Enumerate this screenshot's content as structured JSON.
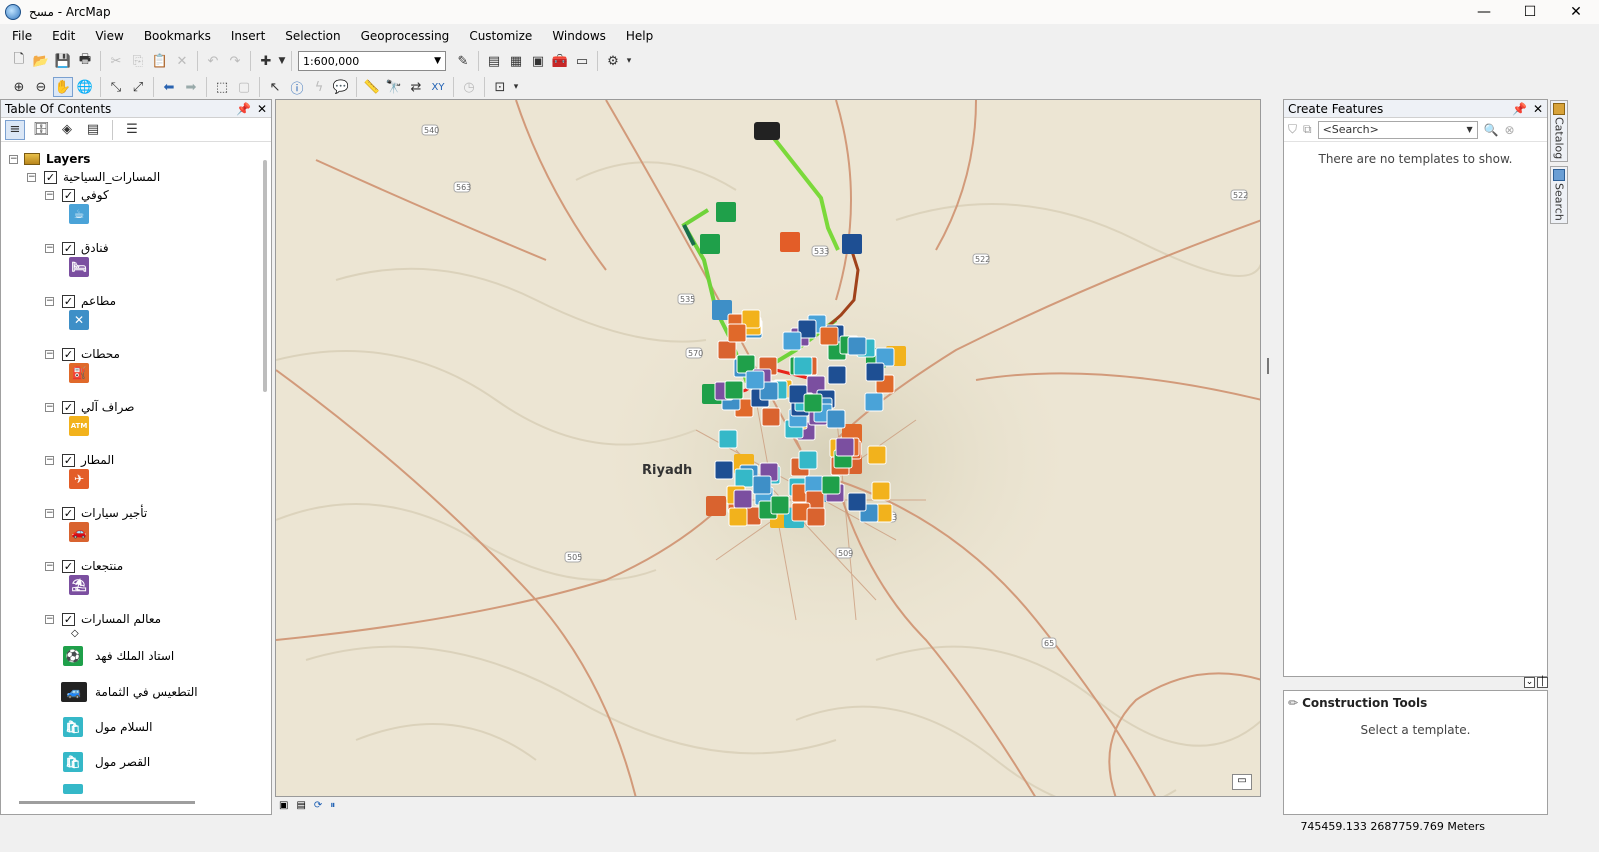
{
  "window": {
    "title": "مسح - ArcMap",
    "minimize": "—",
    "maximize": "☐",
    "close": "✕"
  },
  "menu": [
    "File",
    "Edit",
    "View",
    "Bookmarks",
    "Insert",
    "Selection",
    "Geoprocessing",
    "Customize",
    "Windows",
    "Help"
  ],
  "toolbar": {
    "scale": "1:600,000"
  },
  "toc": {
    "title": "Table Of Contents",
    "root": "Layers",
    "group": "المسارات_السياحية",
    "layers": [
      {
        "name": "كوفي",
        "color": "#4aa3d8",
        "glyph": "☕"
      },
      {
        "name": "فنادق",
        "color": "#7b4fa0",
        "glyph": "🛏"
      },
      {
        "name": "مطاعم",
        "color": "#3e8fc7",
        "glyph": "✕"
      },
      {
        "name": "محطات",
        "color": "#e0692a",
        "glyph": "⛽"
      },
      {
        "name": "صراف آلي",
        "color": "#f2b21c",
        "glyph": "ATM"
      },
      {
        "name": "المطار",
        "color": "#e35d28",
        "glyph": "✈"
      },
      {
        "name": "تأجير سيارات",
        "color": "#d9632f",
        "glyph": "🚗"
      },
      {
        "name": "منتجعات",
        "color": "#7b4fa0",
        "glyph": "⛱"
      }
    ],
    "landmarks_layer": "معالم المسارات",
    "landmark_items": [
      {
        "name": "استاد الملك فهد",
        "color": "#1fa04a",
        "glyph": "⚽"
      },
      {
        "name": "التطعيس في الثمامة",
        "color": "#222222",
        "glyph": "🚙"
      },
      {
        "name": "السلام مول",
        "color": "#35b8c8",
        "glyph": "🛍"
      },
      {
        "name": "القصر مول",
        "color": "#35b8c8",
        "glyph": "🛍"
      }
    ]
  },
  "map": {
    "city_label": "Riyadh",
    "road_shields": [
      "540",
      "563",
      "535",
      "570",
      "533",
      "522",
      "522",
      "505",
      "509",
      "513",
      "65"
    ]
  },
  "create_features": {
    "title": "Create Features",
    "search_placeholder": "<Search>",
    "empty_message": "There are no templates to show."
  },
  "construction_tools": {
    "title": "Construction Tools",
    "message": "Select a template."
  },
  "side_tabs": [
    "Catalog",
    "Search"
  ],
  "status": {
    "coordinates": "745459.133  2687759.769 Meters"
  },
  "icons": [
    "zoom-in-icon",
    "zoom-out-icon",
    "pan-icon",
    "globe-icon",
    "full-extent-icon",
    "identify-icon",
    "find-icon"
  ]
}
